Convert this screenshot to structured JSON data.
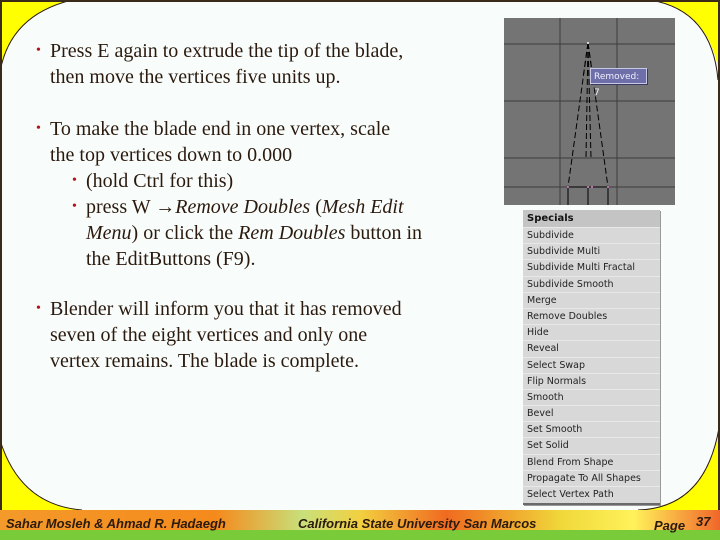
{
  "slide": {
    "bullets": [
      {
        "level": 1,
        "lines": [
          [
            {
              "text": "Press E again to extrude the tip of the blade,",
              "italic": false
            }
          ],
          [
            {
              "text": "then move the vertices five units up.",
              "italic": false
            }
          ]
        ]
      },
      {
        "level": 1,
        "lines": [
          [
            {
              "text": "To make the blade end in one vertex, scale",
              "italic": false
            }
          ],
          [
            {
              "text": "the top vertices down to 0.000",
              "italic": false
            }
          ]
        ]
      },
      {
        "level": 2,
        "lines": [
          [
            {
              "text": "(hold Ctrl for this)",
              "italic": false
            }
          ]
        ]
      },
      {
        "level": 2,
        "lines": [
          [
            {
              "text": "press W ",
              "italic": false
            },
            {
              "text": "→",
              "italic": false
            },
            {
              "text": "Remove Doubles",
              "italic": true
            },
            {
              "text": " (",
              "italic": false
            },
            {
              "text": "Mesh Edit",
              "italic": true
            }
          ],
          [
            {
              "text": "Menu",
              "italic": true
            },
            {
              "text": ") or click the ",
              "italic": false
            },
            {
              "text": "Rem Doubles",
              "italic": true
            },
            {
              "text": " button in",
              "italic": false
            }
          ],
          [
            {
              "text": "the EditButtons (F9).",
              "italic": false
            }
          ]
        ]
      },
      {
        "level": 1,
        "lines": [
          [
            {
              "text": "Blender will inform you that it has removed",
              "italic": false
            }
          ],
          [
            {
              "text": "seven of the eight vertices and only one",
              "italic": false
            }
          ],
          [
            {
              "text": "vertex remains. The blade is complete.",
              "italic": false
            }
          ]
        ]
      }
    ],
    "bullet_glyph": "•"
  },
  "viewport": {
    "tooltip": "Removed: 7"
  },
  "specials_menu": {
    "title": "Specials",
    "items": [
      "Subdivide",
      "Subdivide Multi",
      "Subdivide Multi Fractal",
      "Subdivide Smooth",
      "Merge",
      "Remove Doubles",
      "Hide",
      "Reveal",
      "Select Swap",
      "Flip Normals",
      "Smooth",
      "Bevel",
      "Set Smooth",
      "Set Solid",
      "Blend From Shape",
      "Propagate To All Shapes",
      "Select Vertex Path"
    ]
  },
  "footer": {
    "authors": "Sahar Mosleh & Ahmad R. Hadaegh",
    "institution": "California State University San Marcos",
    "page_label": "Page",
    "page_number": "37"
  },
  "colors": {
    "bullet": "#b3121b",
    "text": "#2b1a0e",
    "corner_yellow": "#ffff00",
    "footer_orange": "#f07a1a",
    "footer_green": "#7acb3a",
    "background": "#f8fdfc"
  }
}
